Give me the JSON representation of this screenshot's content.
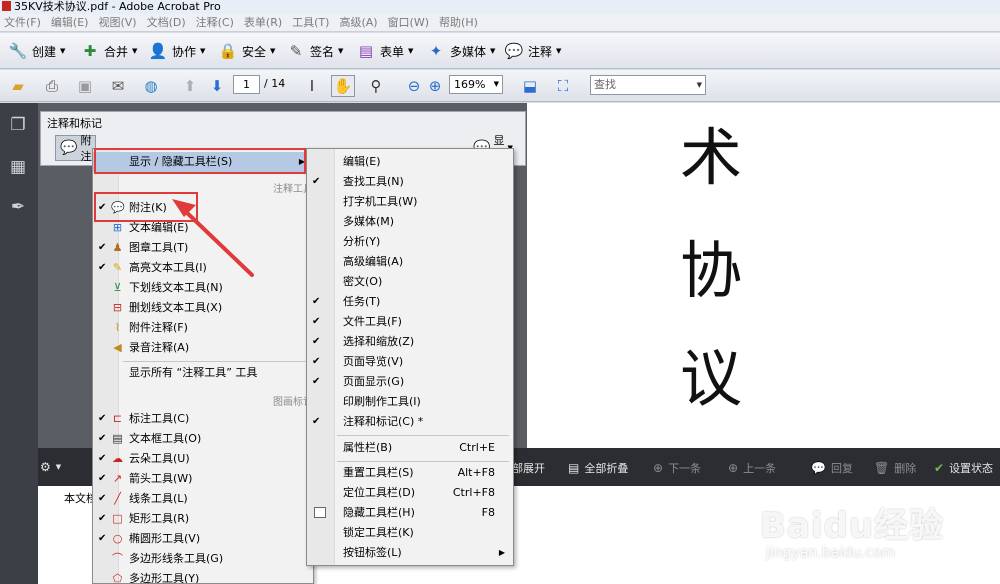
{
  "window": {
    "title": "35KV技术协议.pdf - Adobe Acrobat Pro"
  },
  "menubar": [
    "文件(F)",
    "编辑(E)",
    "视图(V)",
    "文档(D)",
    "注释(C)",
    "表单(R)",
    "工具(T)",
    "高级(A)",
    "窗口(W)",
    "帮助(H)"
  ],
  "toolbar1": {
    "create": "创建",
    "combine": "合并",
    "collaborate": "协作",
    "secure": "安全",
    "sign": "签名",
    "forms": "表单",
    "multimedia": "多媒体",
    "comment": "注释"
  },
  "toolbar2": {
    "page_current": "1",
    "page_total": "/ 14",
    "zoom": "169%",
    "find_placeholder": "查找"
  },
  "document": {
    "chars": [
      "术",
      "协",
      "议"
    ]
  },
  "annot_panel": {
    "title": "注释和标记",
    "note": "附注",
    "show": "显示"
  },
  "comment_bar": {
    "expand_all": "部展开",
    "collapse_all": "全部折叠",
    "next": "下一条",
    "previous": "上一条",
    "reply": "回复",
    "delete": "删除",
    "set_status": "设置状态"
  },
  "comment_list": {
    "column_header": "本文档"
  },
  "menu1": {
    "toggle_toolbar": "显示 / 隐藏工具栏(S)",
    "section_annot": "注释工具",
    "note": "附注(K)",
    "text_edit": "文本编辑(E)",
    "stamp": "图章工具(T)",
    "highlight": "高亮文本工具(I)",
    "underline": "下划线文本工具(N)",
    "strikeout": "删划线文本工具(X)",
    "attach": "附件注释(F)",
    "audio": "录音注释(A)",
    "show_all": "显示所有 “注释工具” 工具",
    "section_drawing": "图画标记",
    "callout": "标注工具(C)",
    "textbox": "文本框工具(O)",
    "cloud": "云朵工具(U)",
    "arrow": "箭头工具(W)",
    "line": "线条工具(L)",
    "rect": "矩形工具(R)",
    "oval": "椭圆形工具(V)",
    "polyline": "多边形线条工具(G)",
    "polygon": "多边形工具(Y)"
  },
  "menu2": {
    "edit": "编辑(E)",
    "find": "查找工具(N)",
    "typewriter": "打字机工具(W)",
    "multimedia": "多媒体(M)",
    "analysis": "分析(Y)",
    "advanced_edit": "高级编辑(A)",
    "secret": "密文(O)",
    "tasks": "任务(T)",
    "file": "文件工具(F)",
    "select_zoom": "选择和缩放(Z)",
    "page_nav": "页面导览(V)",
    "page_display": "页面显示(G)",
    "print_production": "印刷制作工具(I)",
    "comment_markup": "注释和标记(C) *",
    "properties": "属性栏(B)",
    "properties_sc": "Ctrl+E",
    "reset": "重置工具栏(S)",
    "reset_sc": "Alt+F8",
    "dock": "定位工具栏(D)",
    "dock_sc": "Ctrl+F8",
    "hide": "隐藏工具栏(H)",
    "hide_sc": "F8",
    "lock": "锁定工具栏(K)",
    "button_labels": "按钮标签(L)"
  },
  "watermark": {
    "logo": "Baidu经验",
    "url": "jingyan.baidu.com"
  },
  "colors": {
    "annotation_red": "#e03b3b",
    "highlight": "#b6c9e4",
    "nav_dark": "#3c3f45"
  }
}
